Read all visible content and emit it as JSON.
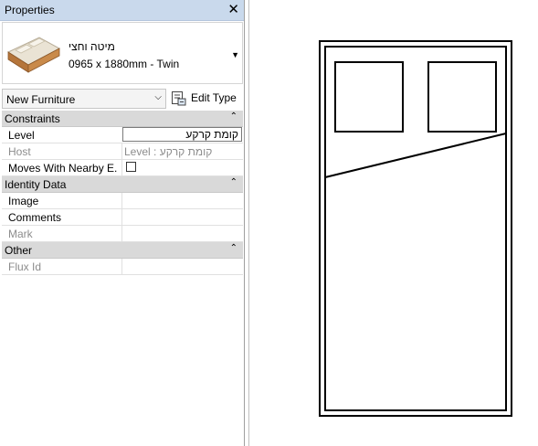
{
  "panel": {
    "title": "Properties",
    "close_glyph": "✕"
  },
  "type_selector": {
    "name": "מיטה וחצי",
    "size": "0965 x 1880mm - Twin",
    "thumbnail_icon": "bed-thumbnail-icon",
    "dropdown_glyph": "▼"
  },
  "category": {
    "value": "New Furniture",
    "chevron": "⌵"
  },
  "edit_type": {
    "label": "Edit Type",
    "icon": "edit-type-icon"
  },
  "groups": {
    "constraints": {
      "label": "Constraints",
      "collapse_glyph": "⌃",
      "level": {
        "name": "Level",
        "value": "קומת קרקע"
      },
      "host": {
        "name": "Host",
        "value": "Level : קומת קרקע"
      },
      "moves": {
        "name": "Moves With Nearby E..."
      }
    },
    "identity": {
      "label": "Identity Data",
      "collapse_glyph": "⌃",
      "image": {
        "name": "Image"
      },
      "comments": {
        "name": "Comments"
      },
      "mark": {
        "name": "Mark"
      }
    },
    "other": {
      "label": "Other",
      "collapse_glyph": "⌃",
      "flux": {
        "name": "Flux Id"
      }
    }
  },
  "canvas": {
    "element": "bed-plan-drawing"
  }
}
